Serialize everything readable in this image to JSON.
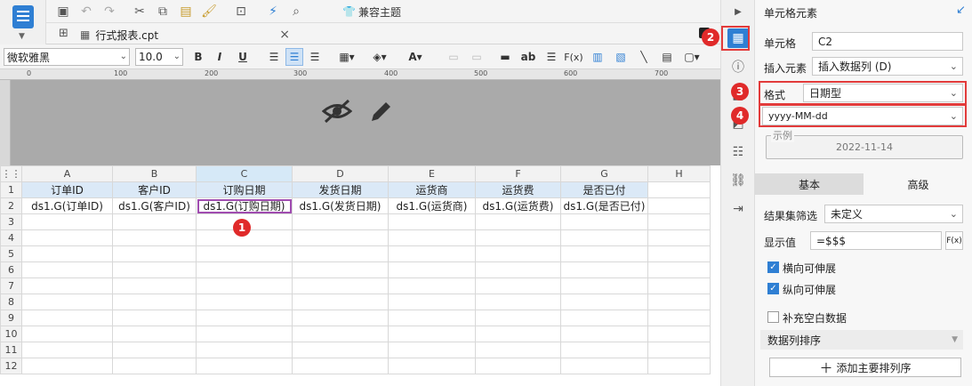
{
  "toolbar": {
    "compat_theme_label": "兼容主题"
  },
  "tab": {
    "filename": "行式报表.cpt",
    "close_glyph": "×"
  },
  "format": {
    "font_name": "微软雅黑",
    "font_size": "10.0",
    "bold": "B",
    "italic": "I",
    "underline": "U",
    "text_ab": "ab",
    "formula": "F(x)"
  },
  "ruler": {
    "ticks": [
      "0",
      "100",
      "200",
      "300",
      "400",
      "500",
      "600",
      "700"
    ]
  },
  "sheet": {
    "columns": [
      "A",
      "B",
      "C",
      "D",
      "E",
      "F",
      "G",
      "H"
    ],
    "selected_column": "C",
    "rows": [
      "1",
      "2",
      "3",
      "4",
      "5",
      "6",
      "7",
      "8",
      "9",
      "10",
      "11",
      "12"
    ],
    "header_row": [
      "订单ID",
      "客户ID",
      "订购日期",
      "发货日期",
      "运货商",
      "运货费",
      "是否已付"
    ],
    "data_row": [
      "ds1.G(订单ID)",
      "ds1.G(客户ID)",
      "ds1.G(订购日期)",
      "ds1.G(发货日期)",
      "ds1.G(运货商)",
      "ds1.G(运货费)",
      "ds1.G(是否已付)"
    ],
    "selected_cell": "C2"
  },
  "badges": [
    "1",
    "2",
    "3",
    "4"
  ],
  "panel": {
    "title": "单元格元素",
    "cell_label": "单元格",
    "cell_value": "C2",
    "insert_label": "插入元素",
    "insert_value": "插入数据列 (D)",
    "format_label": "格式",
    "format_value": "日期型",
    "pattern_value": "yyyy-MM-dd",
    "example_label": "示例",
    "example_value": "2022-11-14",
    "tab_basic": "基本",
    "tab_advanced": "高级",
    "filter_label": "结果集筛选",
    "filter_value": "未定义",
    "display_label": "显示值",
    "display_value": "=$$$",
    "display_fx": "F(x)",
    "chk_horizontal": "横向可伸展",
    "chk_vertical": "纵向可伸展",
    "chk_fill_blank": "补充空白数据",
    "sort_label": "数据列排序",
    "add_sort_button": "添加主要排列序"
  },
  "colors": {
    "accent": "#2f7fd3",
    "badge": "#e02a2a",
    "header_cell": "#dbe9f7",
    "selected_border": "#a04cb0"
  }
}
